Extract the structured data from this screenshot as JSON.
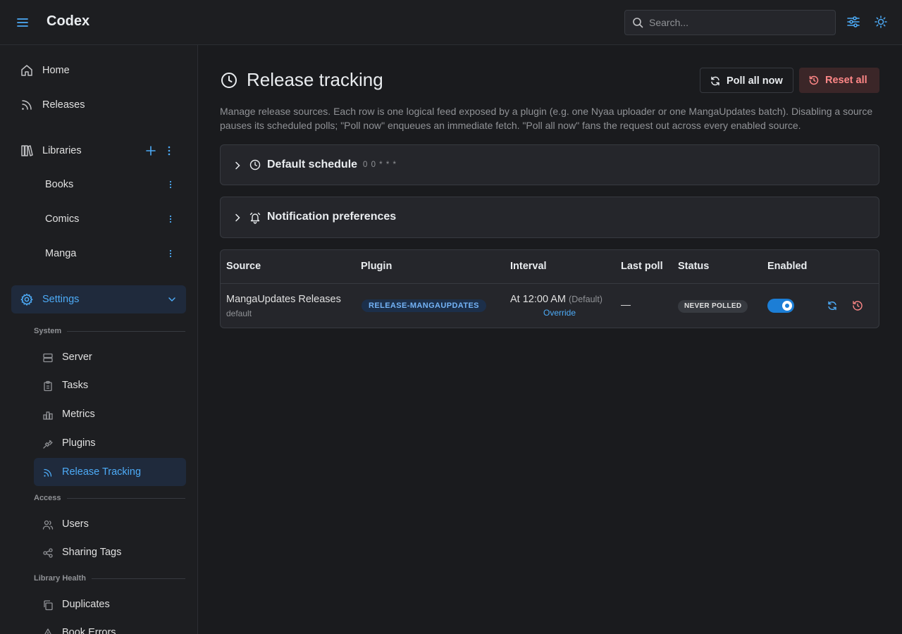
{
  "app": {
    "brand": "Codex"
  },
  "search": {
    "placeholder": "Search..."
  },
  "sidebar": {
    "home": "Home",
    "releases": "Releases",
    "libraries": "Libraries",
    "library_items": [
      "Books",
      "Comics",
      "Manga"
    ],
    "settings": "Settings",
    "sections": {
      "system": "System",
      "access": "Access",
      "library_health": "Library Health"
    },
    "system_items": [
      "Server",
      "Tasks",
      "Metrics",
      "Plugins",
      "Release Tracking"
    ],
    "access_items": [
      "Users",
      "Sharing Tags"
    ],
    "health_items": [
      "Duplicates",
      "Book Errors"
    ]
  },
  "page": {
    "title": "Release tracking",
    "poll_all": "Poll all now",
    "reset_all": "Reset all",
    "description": "Manage release sources. Each row is one logical feed exposed by a plugin (e.g. one Nyaa uploader or one MangaUpdates batch). Disabling a source pauses its scheduled polls; \"Poll now\" enqueues an immediate fetch. \"Poll all now\" fans the request out across every enabled source."
  },
  "panels": {
    "schedule_title": "Default schedule",
    "schedule_cron": "0 0 * * *",
    "notifications_title": "Notification preferences"
  },
  "table": {
    "headers": [
      "Source",
      "Plugin",
      "Interval",
      "Last poll",
      "Status",
      "Enabled"
    ],
    "rows": [
      {
        "source": "MangaUpdates Releases",
        "source_sub": "default",
        "plugin": "RELEASE-MANGAUPDATES",
        "interval": "At 12:00 AM",
        "interval_default": "(Default)",
        "override": "Override",
        "last_poll": "—",
        "status": "NEVER POLLED",
        "enabled": true
      }
    ]
  },
  "colors": {
    "accent": "#4dabf7",
    "danger": "#ff8787",
    "toggle_on": "#1c7ed6"
  }
}
